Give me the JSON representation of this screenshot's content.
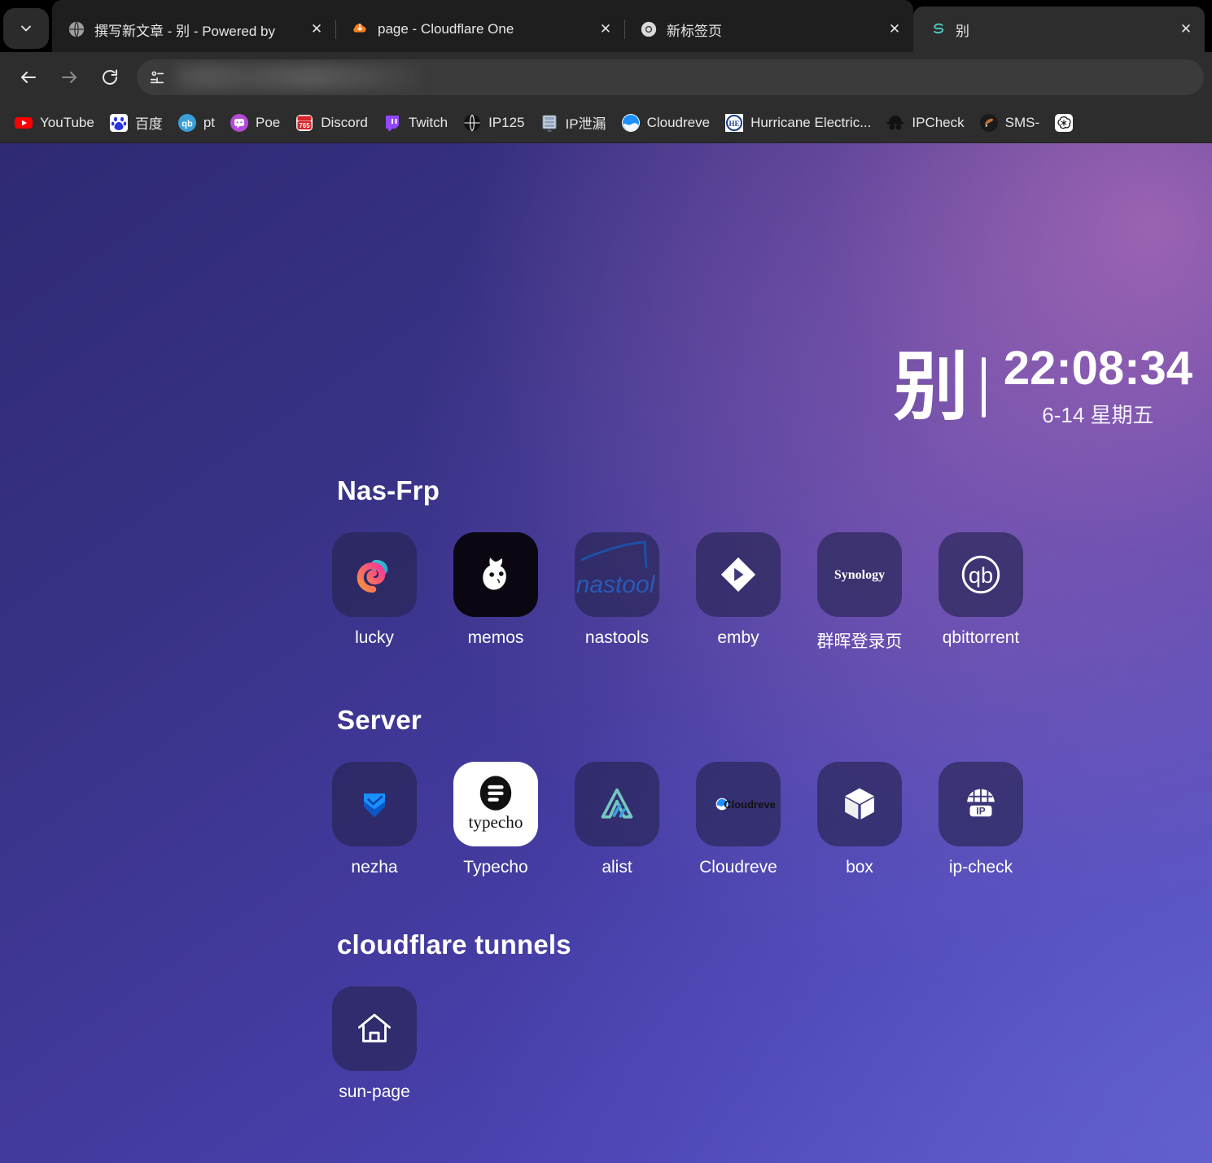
{
  "browser": {
    "tab_search_icon": "chevron-down-icon",
    "tabs": [
      {
        "title": "撰写新文章 - 别 - Powered by",
        "favicon": "globe-icon",
        "active": false,
        "close_label": "✕"
      },
      {
        "title": "page - Cloudflare One",
        "favicon": "cloudflare-icon",
        "active": false,
        "close_label": "✕"
      },
      {
        "title": "新标签页",
        "favicon": "chrome-icon",
        "active": false,
        "close_label": "✕"
      },
      {
        "title": "别",
        "favicon": "sun-panel-icon",
        "active": true,
        "close_label": "✕"
      }
    ],
    "nav": {
      "back_icon": "arrow-left-icon",
      "forward_icon": "arrow-right-icon",
      "reload_icon": "reload-icon"
    },
    "omnibox": {
      "value": "",
      "placeholder": "",
      "leading_icon": "site-info-icon",
      "redacted": true
    },
    "bookmarks": [
      {
        "label": "YouTube",
        "icon": "youtube-icon"
      },
      {
        "label": "百度",
        "icon": "baidu-icon"
      },
      {
        "label": "pt",
        "icon": "qbittorrent-icon"
      },
      {
        "label": "Poe",
        "icon": "poe-icon"
      },
      {
        "label": "Discord",
        "icon": "discord-icon"
      },
      {
        "label": "Twitch",
        "icon": "twitch-icon"
      },
      {
        "label": "IP125",
        "icon": "globe-dark-icon"
      },
      {
        "label": "IP泄漏",
        "icon": "server-rack-icon"
      },
      {
        "label": "Cloudreve",
        "icon": "cloudreve-icon"
      },
      {
        "label": "Hurricane Electric...",
        "icon": "hurricane-electric-icon"
      },
      {
        "label": "IPCheck",
        "icon": "spy-icon"
      },
      {
        "label": "SMS-",
        "icon": "hand-icon"
      },
      {
        "label": "",
        "icon": "openai-icon"
      }
    ]
  },
  "dashboard": {
    "brand": "别",
    "time": "22:08:34",
    "date": "6-14 星期五",
    "sections": [
      {
        "title": "Nas-Frp",
        "items": [
          {
            "label": "lucky",
            "icon": "lucky-icon",
            "style": "default"
          },
          {
            "label": "memos",
            "icon": "memos-icon",
            "style": "dark"
          },
          {
            "label": "nastools",
            "icon": "nastools-icon",
            "style": "default"
          },
          {
            "label": "emby",
            "icon": "emby-icon",
            "style": "default"
          },
          {
            "label": "群晖登录页",
            "icon": "synology-icon",
            "style": "default"
          },
          {
            "label": "qbittorrent",
            "icon": "qbittorrent-icon",
            "style": "default"
          }
        ]
      },
      {
        "title": "Server",
        "items": [
          {
            "label": "nezha",
            "icon": "nezha-icon",
            "style": "default"
          },
          {
            "label": "Typecho",
            "icon": "typecho-icon",
            "style": "white"
          },
          {
            "label": "alist",
            "icon": "alist-icon",
            "style": "default"
          },
          {
            "label": "Cloudreve",
            "icon": "cloudreve-icon",
            "style": "default"
          },
          {
            "label": "box",
            "icon": "box-cube-icon",
            "style": "default"
          },
          {
            "label": "ip-check",
            "icon": "ip-globe-icon",
            "style": "default"
          }
        ]
      },
      {
        "title": "cloudflare tunnels",
        "items": [
          {
            "label": "sun-page",
            "icon": "home-icon",
            "style": "default"
          }
        ]
      }
    ]
  },
  "colors": {
    "bg_start": "#2f2a73",
    "bg_end": "#5b55c4",
    "glow": "#ca78be",
    "tile_bg": "#262452",
    "chrome_bg": "#2d2d2d",
    "tabstrip_bg": "#000000",
    "text": "#ffffff"
  }
}
